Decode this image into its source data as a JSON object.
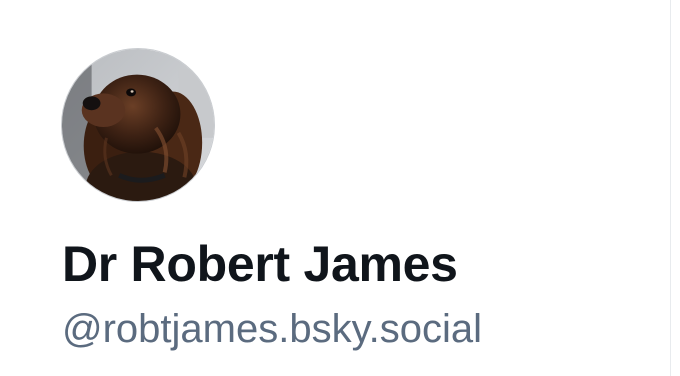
{
  "profile": {
    "display_name": "Dr Robert James",
    "handle": "@robtjames.bsky.social",
    "avatar": {
      "icon": "dog-avatar-icon"
    }
  },
  "colors": {
    "name_text": "#10151b",
    "handle_text": "#5b6b7f",
    "background": "#ffffff"
  }
}
